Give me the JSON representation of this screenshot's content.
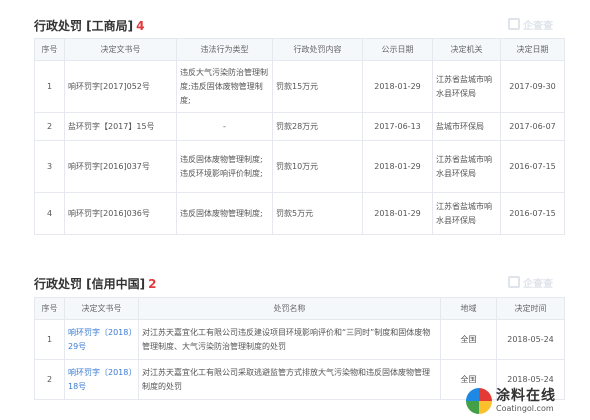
{
  "section1": {
    "title": "行政处罚 [工商局]",
    "count": "4",
    "watermark": "企查查",
    "headers": [
      "序号",
      "决定文书号",
      "违法行为类型",
      "行政处罚内容",
      "公示日期",
      "决定机关",
      "决定日期"
    ],
    "rows": [
      [
        "1",
        "响环罚字[2017]052号",
        "违反大气污染防治管理制度;违反固体废物管理制度;",
        "罚款15万元",
        "2018-01-29",
        "江苏省盐城市响水县环保局",
        "2017-09-30"
      ],
      [
        "2",
        "盐环罚字【2017】15号",
        "-",
        "罚款28万元",
        "2017-06-13",
        "盐城市环保局",
        "2017-06-07"
      ],
      [
        "3",
        "响环罚字[2016]037号",
        "违反固体废物管理制度;违反环境影响评价制度;",
        "罚款10万元",
        "2018-01-29",
        "江苏省盐城市响水县环保局",
        "2016-07-15"
      ],
      [
        "4",
        "响环罚字[2016]036号",
        "违反固体废物管理制度;",
        "罚款5万元",
        "2018-01-29",
        "江苏省盐城市响水县环保局",
        "2016-07-15"
      ]
    ]
  },
  "section2": {
    "title": "行政处罚 [信用中国]",
    "count": "2",
    "watermark": "企查查",
    "headers": [
      "序号",
      "决定文书号",
      "处罚名称",
      "地域",
      "决定时间"
    ],
    "rows": [
      [
        "1",
        "响环罚字〔2018〕29号",
        "对江苏天嘉宜化工有限公司违反建设项目环境影响评价和“三同时”制度和固体废物管理制度、大气污染防治管理制度的处罚",
        "全国",
        "2018-05-24"
      ],
      [
        "2",
        "响环罚字〔2018〕18号",
        "对江苏天嘉宜化工有限公司采取逃避监管方式排放大气污染物和违反固体废物管理制度的处罚",
        "全国",
        "2018-05-24"
      ]
    ]
  },
  "footer": {
    "cn": "涂料在线",
    "en": "Coatingol.com"
  }
}
